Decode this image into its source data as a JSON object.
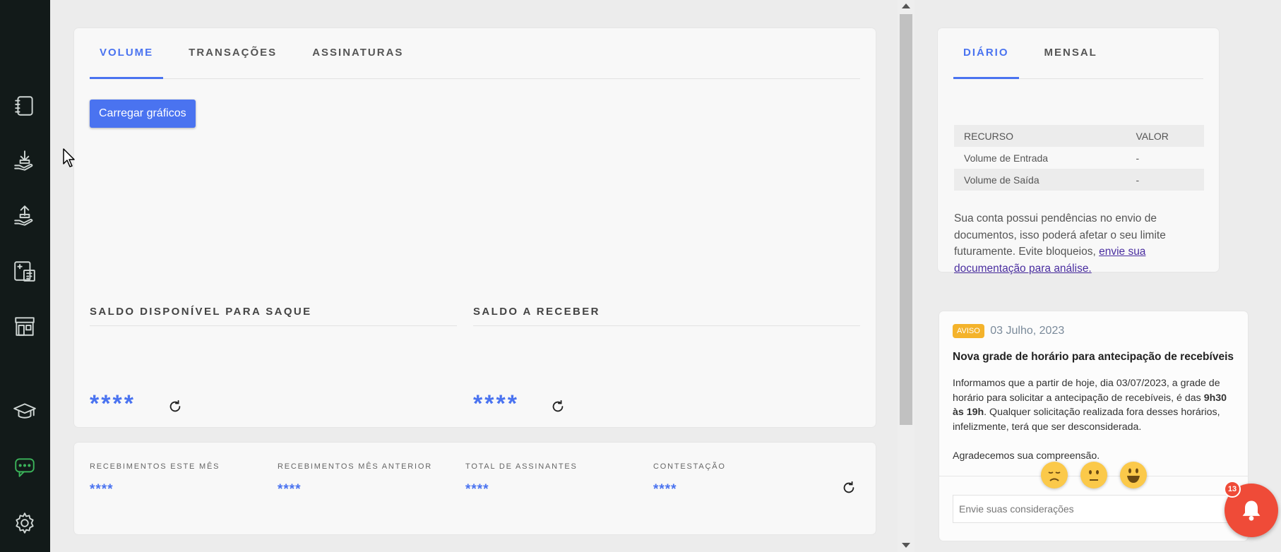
{
  "sidebar": {
    "items": [
      {
        "icon": "notebook-icon"
      },
      {
        "icon": "receive-money-icon"
      },
      {
        "icon": "send-money-icon"
      },
      {
        "icon": "calculator-icon"
      },
      {
        "icon": "store-icon"
      },
      {
        "icon": "graduation-cap-icon"
      },
      {
        "icon": "chat-icon",
        "active": true
      },
      {
        "icon": "gear-icon"
      }
    ],
    "active_color": "#3bb35a"
  },
  "main": {
    "tabs": [
      {
        "label": "VOLUME",
        "active": true
      },
      {
        "label": "TRANSAÇÕES",
        "active": false
      },
      {
        "label": "ASSINATURAS",
        "active": false
      }
    ],
    "load_button": "Carregar gráficos",
    "balances": [
      {
        "title": "SALDO DISPONÍVEL PARA SAQUE",
        "value": "****"
      },
      {
        "title": "SALDO A RECEBER",
        "value": "****"
      }
    ]
  },
  "stats": {
    "items": [
      {
        "label": "RECEBIMENTOS ESTE MÊS",
        "value": "****"
      },
      {
        "label": "RECEBIMENTOS MÊS ANTERIOR",
        "value": "****"
      },
      {
        "label": "TOTAL DE ASSINANTES",
        "value": "****"
      },
      {
        "label": "CONTESTAÇÃO",
        "value": "****"
      }
    ]
  },
  "summary": {
    "tabs": [
      {
        "label": "DIÁRIO",
        "active": true
      },
      {
        "label": "MENSAL",
        "active": false
      }
    ],
    "table": {
      "headers": [
        "RECURSO",
        "VALOR"
      ],
      "rows": [
        [
          "Volume de Entrada",
          "-"
        ],
        [
          "Volume de Saída",
          "-"
        ]
      ]
    },
    "pending_text": "Sua conta possui pendências no envio de documentos, isso poderá afetar o seu limite futuramente. Evite bloqueios,",
    "pending_link": "envie sua documentação para análise."
  },
  "notice": {
    "badge": "AVISO",
    "date": "03 Julho, 2023",
    "title": "Nova grade de horário para antecipação de recebíveis",
    "body_part1": "Informamos que a partir de hoje, dia 03/07/2023, a grade de horário para solicitar a antecipação de recebíveis, é das",
    "body_bold": "9h30 às 19h",
    "body_part2": ". Qualquer solicitação realizada fora desses horários, infelizmente, terá que ser desconsiderada.",
    "thanks": "Agradecemos sua compreensão.",
    "feedback_placeholder": "Envie suas considerações"
  },
  "notifications": {
    "count": "13"
  },
  "colors": {
    "accent": "#4a73f0",
    "badge": "#f4b32b",
    "bell": "#ef4b38"
  }
}
